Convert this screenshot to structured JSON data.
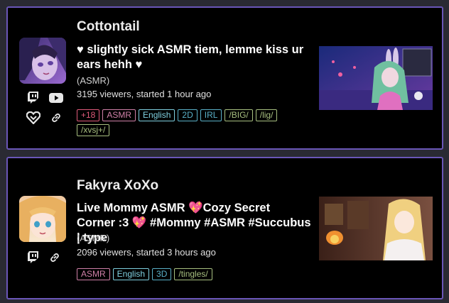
{
  "streams": [
    {
      "name": "Cottontail",
      "title": "♥ slightly sick ASMR tiem, lemme kiss ur ears hehh ♥",
      "category": "(ASMR)",
      "stats": "3195 viewers, started 1 hour ago",
      "tags": [
        {
          "label": "+18",
          "color": "#e05a7a"
        },
        {
          "label": "ASMR",
          "color": "#d080a8"
        },
        {
          "label": "English",
          "color": "#7fd0e0"
        },
        {
          "label": "2D",
          "color": "#5ab0c8"
        },
        {
          "label": "IRL",
          "color": "#5ab0c8"
        },
        {
          "label": "/BIG/",
          "color": "#a8c080"
        },
        {
          "label": "/lig/",
          "color": "#a8c080"
        },
        {
          "label": "/xvsj+/",
          "color": "#a8c080"
        }
      ],
      "icons": [
        "twitch-icon",
        "youtube-icon",
        "heart-link-icon",
        "link-icon"
      ]
    },
    {
      "name": "Fakyra XoXo",
      "title": "Live Mommy ASMR 💖Cozy Secret Corner :3 💖 #Mommy #ASMR #Succubus | type",
      "category": "(ASMR)",
      "stats": "2096 viewers, started 3 hours ago",
      "tags": [
        {
          "label": "ASMR",
          "color": "#d080a8"
        },
        {
          "label": "English",
          "color": "#7fd0e0"
        },
        {
          "label": "3D",
          "color": "#5ab0c8"
        },
        {
          "label": "/tingles/",
          "color": "#a8c080"
        }
      ],
      "icons": [
        "twitch-icon",
        "link-icon"
      ]
    }
  ],
  "colors": {
    "background": "#2a2a33",
    "card": "#000000",
    "card_border": "#6a56b8"
  }
}
